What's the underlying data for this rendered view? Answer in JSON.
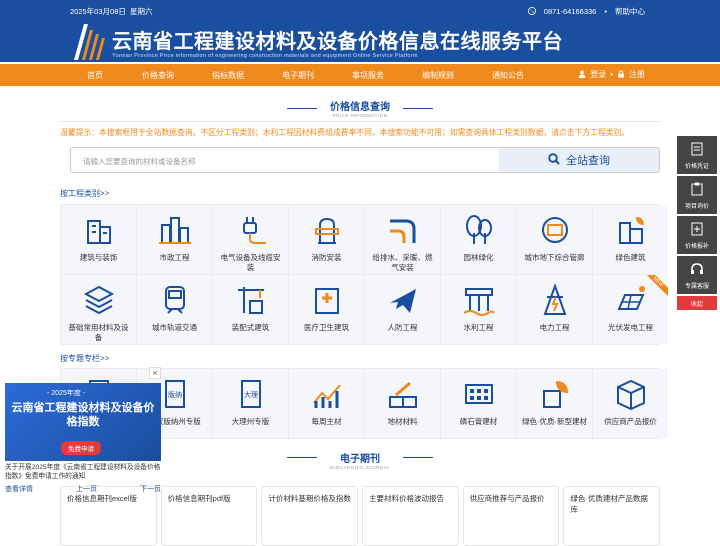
{
  "header": {
    "date": "2025年03月08日",
    "weekday": "星期六",
    "phone": "0871-64166336",
    "help": "帮助中心",
    "title": "云南省工程建设材料及设备价格信息在线服务平台",
    "subtitle": "Yunnan Province Price information of engineering construction materials and equipment Online Service Platform"
  },
  "nav": {
    "items": [
      "首页",
      "价格查询",
      "指标数据",
      "电子期刊",
      "事项服务",
      "编制规则",
      "通知公告"
    ],
    "login": "登录",
    "register": "注册"
  },
  "price_section": {
    "title": "价格信息查询",
    "en": "PRICE INFORMATION",
    "tip": "温馨提示：本搜索框用于全站数据查询，不区分工程类别；水利工程因材料费组成费率不同，本搜索功能不可用；如需查询具体工程类别数据，请点击下方工程类别。",
    "search_placeholder": "请输入您要查询的材料或设备名称",
    "search_button": "全站查询"
  },
  "category_link": "按工程类别>>",
  "categories": [
    {
      "label": "建筑与装饰",
      "icon": "building-icon"
    },
    {
      "label": "市政工程",
      "icon": "city-icon"
    },
    {
      "label": "电气设备及线缆安装",
      "icon": "plug-icon"
    },
    {
      "label": "消防安装",
      "icon": "hydrant-icon"
    },
    {
      "label": "给排水、采暖、燃气安装",
      "icon": "pipe-icon"
    },
    {
      "label": "园林绿化",
      "icon": "tree-icon"
    },
    {
      "label": "城市地下综合管廊",
      "icon": "tunnel-icon"
    },
    {
      "label": "绿色建筑",
      "icon": "green-building-icon"
    },
    {
      "label": "基础常用材料及设备",
      "icon": "layers-icon"
    },
    {
      "label": "城市轨道交通",
      "icon": "train-icon"
    },
    {
      "label": "装配式建筑",
      "icon": "crane-icon"
    },
    {
      "label": "医疗卫生建筑",
      "icon": "hospital-icon"
    },
    {
      "label": "人防工程",
      "icon": "plane-icon"
    },
    {
      "label": "水利工程",
      "icon": "dam-icon"
    },
    {
      "label": "电力工程",
      "icon": "tower-icon"
    },
    {
      "label": "光伏发电工程",
      "icon": "solar-icon"
    }
  ],
  "new_badge": "NEW",
  "topic_link": "按专题专栏>>",
  "topics": [
    {
      "label": "",
      "icon": "doc-icon"
    },
    {
      "label": "西双版纳州专版",
      "icon": "banna-icon"
    },
    {
      "label": "大理州专版",
      "icon": "dali-icon"
    },
    {
      "label": "每周主材",
      "icon": "chart-icon"
    },
    {
      "label": "地材材料",
      "icon": "brick-icon"
    },
    {
      "label": "磷石膏建材",
      "icon": "block-icon"
    },
    {
      "label": "绿色·优质·新型建材",
      "icon": "eco-icon"
    },
    {
      "label": "供应商产品报价",
      "icon": "box-icon"
    }
  ],
  "topic_badges": {
    "banna": "版纳",
    "dali": "大理"
  },
  "ebook": {
    "title": "电子期刊",
    "en": "ELECTRONIC JOURNAL",
    "cards": [
      "价格信息期刊excel版",
      "价格信息期刊pdf版",
      "计价材料基期价格及指数",
      "主要材料价格波动报告",
      "供应商推荐与产品报价",
      "绿色·优质建材产品数据库"
    ]
  },
  "side": {
    "items": [
      "价格凭证",
      "项目询价",
      "价格报补",
      "专属客服"
    ],
    "collapse": "收起"
  },
  "popup": {
    "year": "- 2025年度 -",
    "title": "云南省工程建设材料及设备价格指数",
    "button": "免费申请",
    "desc": "关于开展2025年度《云南省工程建设材料及设备价格指数》免费申请工作的通知",
    "detail": "查看详情",
    "prev": "上一页",
    "next": "下一页",
    "close": "×"
  },
  "colors": {
    "primary": "#1a4e9e",
    "accent": "#f08a1c",
    "red": "#e23b3b"
  }
}
